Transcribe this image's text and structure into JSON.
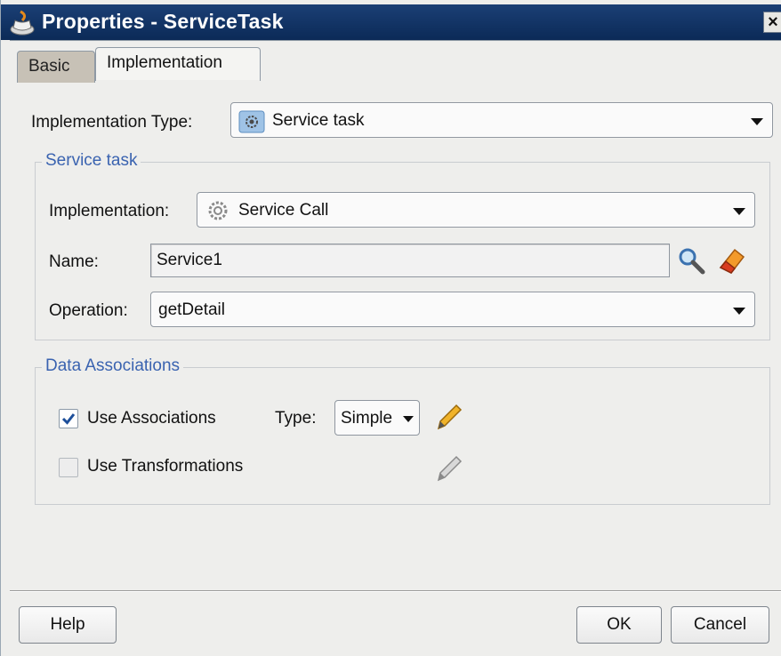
{
  "window": {
    "title": "Properties - ServiceTask",
    "close_label": "×"
  },
  "tabs": [
    {
      "label": "Basic",
      "selected": false
    },
    {
      "label": "Implementation",
      "selected": true
    }
  ],
  "implementation_type": {
    "label": "Implementation Type:",
    "value": "Service task",
    "icon": "service-task-icon"
  },
  "service_task_group": {
    "title": "Service task",
    "implementation": {
      "label": "Implementation:",
      "value": "Service Call",
      "icon": "gear-icon"
    },
    "name": {
      "label": "Name:",
      "value": "Service1"
    },
    "operation": {
      "label": "Operation:",
      "value": "getDetail"
    }
  },
  "data_associations_group": {
    "title": "Data Associations",
    "use_associations": {
      "label": "Use Associations",
      "checked": true
    },
    "type": {
      "label": "Type:",
      "value": "Simple"
    },
    "use_transformations": {
      "label": "Use Transformations",
      "checked": false
    }
  },
  "buttons": {
    "help": "Help",
    "ok": "OK",
    "cancel": "Cancel"
  },
  "colors": {
    "titlebar": "#0b2a57",
    "group_title": "#3a63b0",
    "pencil_active": "#e0a020"
  }
}
